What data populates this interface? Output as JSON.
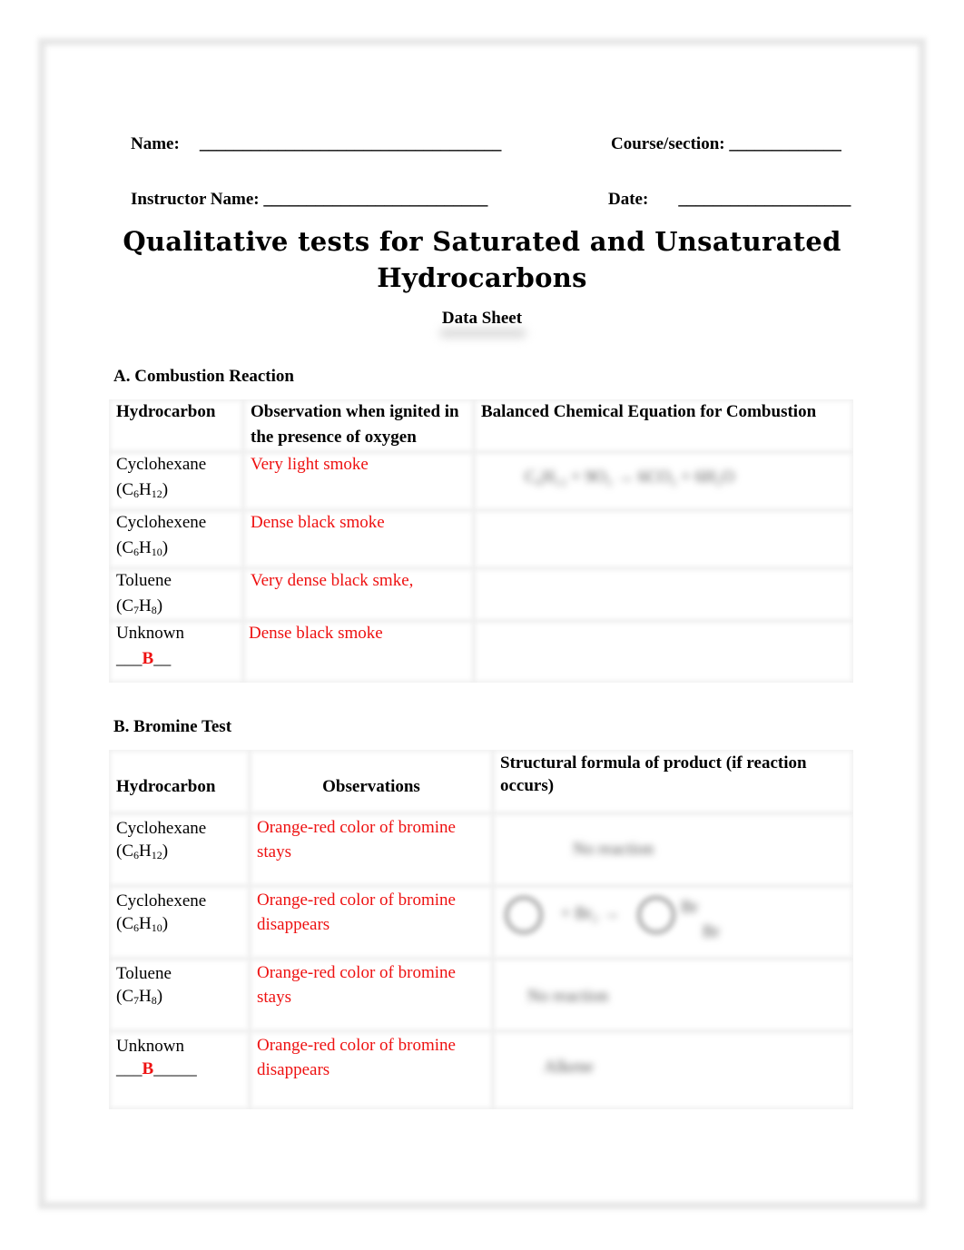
{
  "header": {
    "name_label": "Name:",
    "name_blank": "___________________________________",
    "course_label": "Course/section:",
    "course_blank": "_____________",
    "instructor_label": "Instructor Name:",
    "instructor_blank": "__________________________",
    "date_label": "Date:",
    "date_blank": "____________________"
  },
  "title_line1": "Qualitative tests for Saturated and Unsaturated",
  "title_line2": "Hydrocarbons",
  "subtitle": "Data Sheet",
  "section_a": {
    "heading": "A.  Combustion Reaction",
    "columns": [
      "Hydrocarbon",
      "Observation when ignited in the presence of oxygen",
      "Balanced Chemical Equation for Combustion"
    ],
    "rows": [
      {
        "name": "Cyclohexane",
        "formula_c": "6",
        "formula_h": "12",
        "observation": "Very light smoke",
        "equation": "[blurred]"
      },
      {
        "name": "Cyclohexene",
        "formula_c": "6",
        "formula_h": "10",
        "observation": "Dense black smoke",
        "equation": ""
      },
      {
        "name": "Toluene",
        "formula_c": "7",
        "formula_h": "8",
        "observation": "Very dense black smke,",
        "equation": ""
      },
      {
        "name": "Unknown",
        "unknown_prefix": "___",
        "unknown_id": "B",
        "unknown_suffix": "__",
        "observation": "Dense black smoke",
        "equation": ""
      }
    ]
  },
  "section_b": {
    "heading": "B.  Bromine Test",
    "columns": [
      "Hydrocarbon",
      "Observations",
      "Structural formula of product (if reaction occurs)"
    ],
    "rows": [
      {
        "name": "Cyclohexane",
        "formula_c": "6",
        "formula_h": "12",
        "observation": "Orange-red color of bromine stays",
        "product": "[blurred]"
      },
      {
        "name": "Cyclohexene",
        "formula_c": "6",
        "formula_h": "10",
        "observation": "Orange-red color of bromine disappears",
        "product": "[blurred structure]"
      },
      {
        "name": "Toluene",
        "formula_c": "7",
        "formula_h": "8",
        "observation": "Orange-red color of bromine stays",
        "product": "[blurred]"
      },
      {
        "name": "Unknown",
        "unknown_prefix": "___",
        "unknown_id": "B",
        "unknown_suffix": "_____",
        "observation": "Orange-red color of bromine disappears",
        "product": "[blurred]"
      }
    ]
  },
  "colors": {
    "answer_red": "#ee1111",
    "frame_gray": "#e6e6e6"
  }
}
